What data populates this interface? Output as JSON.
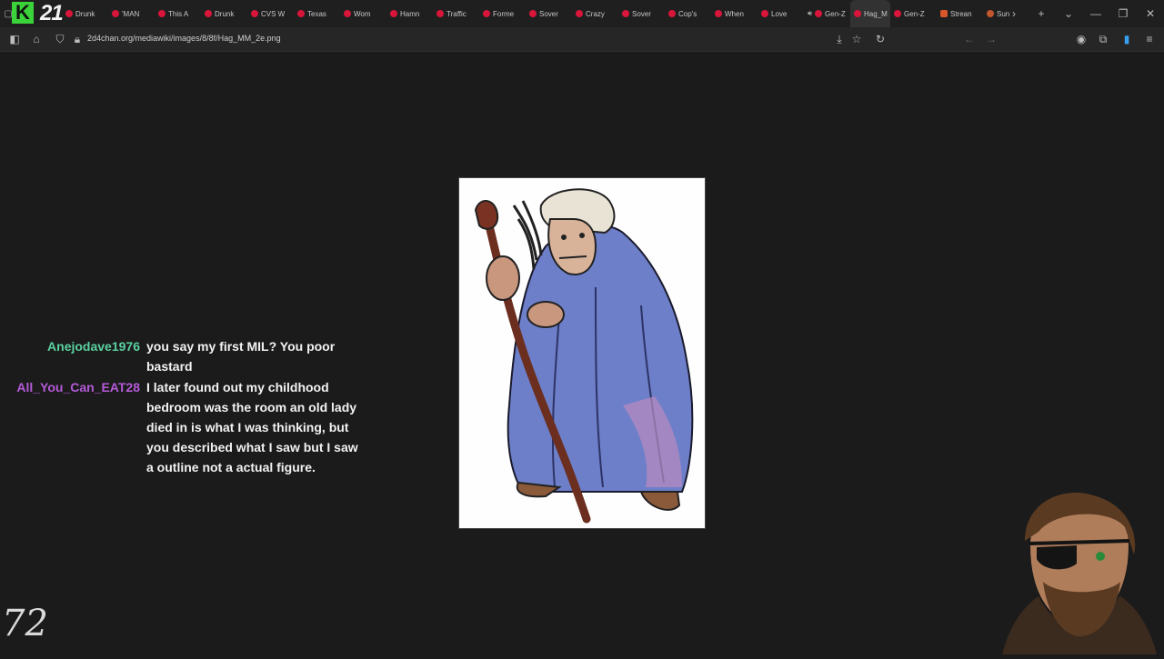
{
  "browser": {
    "tabs": [
      {
        "label": "Drunk"
      },
      {
        "label": "'MAN"
      },
      {
        "label": "This A"
      },
      {
        "label": "Drunk"
      },
      {
        "label": "CVS W"
      },
      {
        "label": "Texas"
      },
      {
        "label": "Wom"
      },
      {
        "label": "Hamn"
      },
      {
        "label": "Traffic"
      },
      {
        "label": "Forme"
      },
      {
        "label": "Sover"
      },
      {
        "label": "Crazy"
      },
      {
        "label": "Sover"
      },
      {
        "label": "Cop's"
      },
      {
        "label": "When"
      },
      {
        "label": "Love"
      },
      {
        "label": "Gen-Z"
      },
      {
        "label": "Hag_M"
      },
      {
        "label": "Gen-Z"
      },
      {
        "label": "Strean"
      },
      {
        "label": "Sun"
      }
    ],
    "active_tab_index": 17,
    "url": "2d4chan.org/mediawiki/images/8/8f/Hag_MM_2e.png",
    "accent_color": "#d8153a"
  },
  "overlay": {
    "channel_logo_text": "21",
    "chan_logo_text": "72"
  },
  "chat": [
    {
      "user": "Anejodave1976",
      "color": "#5ad0a0",
      "text": "you say my first MIL? You poor bastard"
    },
    {
      "user": "All_You_Can_EAT28",
      "color": "#b45ad8",
      "text": "I later found out my childhood bedroom was the room an old lady died in is what I was thinking, but you described what I saw but I saw a outline not a actual figure."
    }
  ],
  "image": {
    "subject": "hag-illustration"
  }
}
